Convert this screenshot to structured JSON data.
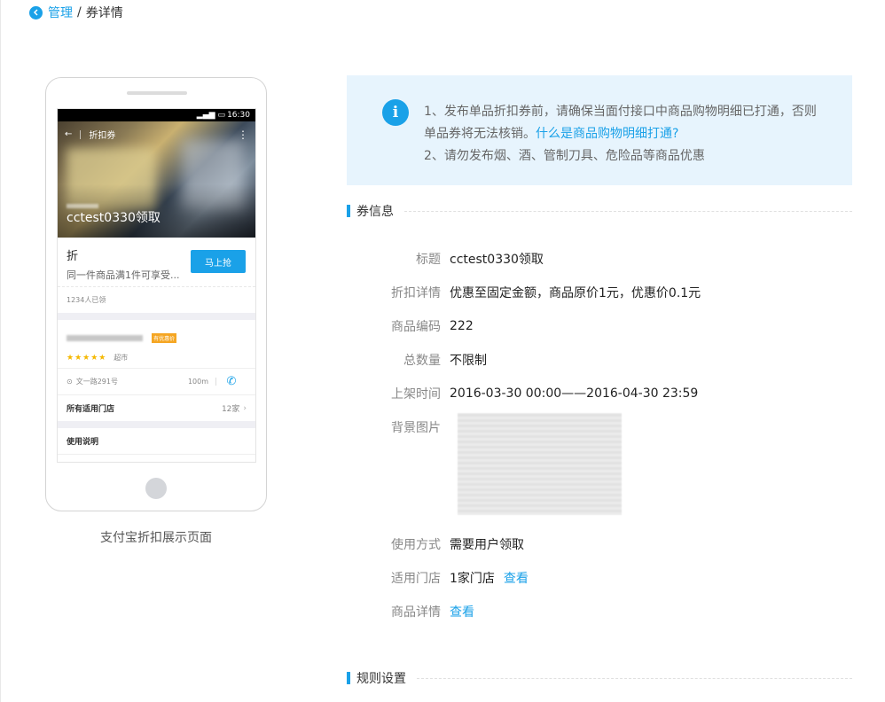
{
  "breadcrumb": {
    "parent": "管理",
    "separator": "/",
    "current": "券详情"
  },
  "preview": {
    "status_time": "16:30",
    "nav_title": "折扣券",
    "hero_title": "cctest0330领取",
    "coupon_type": "折",
    "coupon_desc": "同一件商品满1件可享受...",
    "grab_button": "马上抢",
    "claimed": "1234人已领",
    "store_tag": "有优惠价",
    "stars": "★★★★★",
    "store_category": "超市",
    "address": "文一路291号",
    "distance": "100m",
    "applicable_stores_label": "所有适用门店",
    "applicable_stores_count": "12家",
    "usage_label": "使用说明",
    "caption": "支付宝折扣展示页面"
  },
  "notice": {
    "line1": "1、发布单品折扣券前，请确保当面付接口中商品购物明细已打通，否则",
    "line2_text": "单品券将无法核销。",
    "line2_link": "什么是商品购物明细打通?",
    "line3": "2、请勿发布烟、酒、管制刀具、危险品等商品优惠"
  },
  "coupon_section": {
    "title": "券信息"
  },
  "fields": {
    "title": {
      "label": "标题",
      "value": "cctest0330领取"
    },
    "discount": {
      "label": "折扣详情",
      "value": "优惠至固定金额，商品原价1元，优惠价0.1元"
    },
    "code": {
      "label": "商品编码",
      "value": "222"
    },
    "total": {
      "label": "总数量",
      "value": "不限制"
    },
    "period": {
      "label": "上架时间",
      "value": "2016-03-30 00:00——2016-04-30 23:59"
    },
    "background": {
      "label": "背景图片"
    },
    "usage": {
      "label": "使用方式",
      "value": "需要用户领取"
    },
    "stores": {
      "label": "适用门店",
      "value": "1家门店",
      "link": "查看"
    },
    "product": {
      "label": "商品详情",
      "link": "查看"
    }
  },
  "rules_section": {
    "title": "规则设置"
  },
  "colors": {
    "accent": "#1aa1e8",
    "notice_bg": "#e7f4fd"
  }
}
